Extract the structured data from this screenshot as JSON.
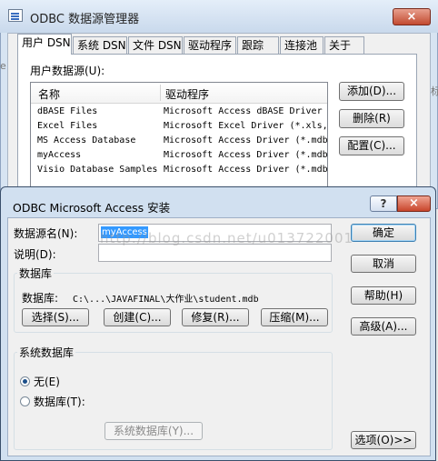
{
  "admin_window": {
    "title": "ODBC 数据源管理器",
    "tabs": [
      "用户 DSN",
      "系统 DSN",
      "文件 DSN",
      "驱动程序",
      "跟踪",
      "连接池",
      "关于"
    ],
    "user_dsn_label": "用户数据源(U):",
    "list_headers": {
      "name": "名称",
      "driver": "驱动程序"
    },
    "data_sources": [
      {
        "name": "dBASE Files",
        "driver": "Microsoft Access dBASE Driver"
      },
      {
        "name": "Excel Files",
        "driver": "Microsoft Excel Driver (*.xls,"
      },
      {
        "name": "MS Access Database",
        "driver": "Microsoft Access Driver (*.mdb"
      },
      {
        "name": "myAccess",
        "driver": "Microsoft Access Driver (*.mdb"
      },
      {
        "name": "Visio Database Samples",
        "driver": "Microsoft Access Driver (*.mdb"
      }
    ],
    "buttons": {
      "add": "添加(D)...",
      "remove": "删除(R)",
      "configure": "配置(C)..."
    },
    "close_glyph": "×",
    "edge_char_left": "e",
    "edge_char_right": "标"
  },
  "setup_dialog": {
    "title": "ODBC Microsoft Access 安装",
    "help_glyph": "?",
    "close_glyph": "×",
    "dsn_label": "数据源名(N):",
    "dsn_value": "myAccess",
    "description_label": "说明(D):",
    "description_value": "",
    "database_group": {
      "title": "数据库",
      "db_label": "数据库:",
      "db_path": "C:\\...\\JAVAFINAL\\大作业\\student.mdb",
      "select": "选择(S)...",
      "create": "创建(C)...",
      "repair": "修复(R)...",
      "compact": "压缩(M)..."
    },
    "system_db_group": {
      "title": "系统数据库",
      "none_label": "无(E)",
      "database_label": "数据库(T):",
      "system_db_button": "系统数据库(Y)..."
    },
    "buttons": {
      "ok": "确定",
      "cancel": "取消",
      "help": "帮助(H)",
      "advanced": "高级(A)...",
      "options": "选项(O)>>"
    },
    "watermark": "http://blog.csdn.net/u013722001"
  }
}
